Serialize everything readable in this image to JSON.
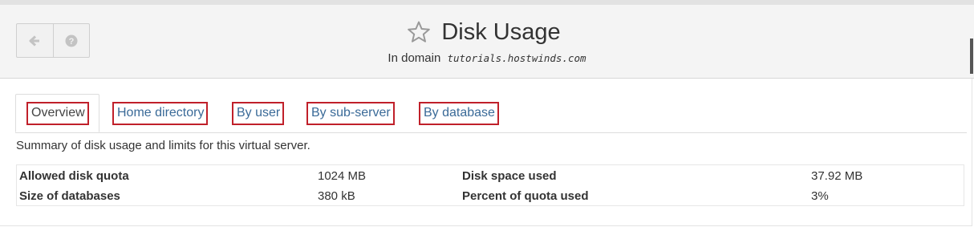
{
  "header": {
    "title": "Disk Usage",
    "subtitle_prefix": "In domain",
    "domain": "tutorials.hostwinds.com"
  },
  "toolbar": {
    "back_icon": "arrow-left-icon",
    "help_icon": "question-circle-icon"
  },
  "tabs": [
    {
      "label": "Overview",
      "active": true
    },
    {
      "label": "Home directory",
      "active": false
    },
    {
      "label": "By user",
      "active": false
    },
    {
      "label": "By sub-server",
      "active": false
    },
    {
      "label": "By database",
      "active": false
    }
  ],
  "summary": "Summary of disk usage and limits for this virtual server.",
  "stats": {
    "allowed_label": "Allowed disk quota",
    "allowed_value": "1024 MB",
    "used_label": "Disk space used",
    "used_value": "37.92 MB",
    "db_label": "Size of databases",
    "db_value": "380 kB",
    "percent_label": "Percent of quota used",
    "percent_value": "3%"
  },
  "colors": {
    "link": "#3a6a98",
    "highlight_border": "#c0202a",
    "header_bg": "#f4f4f4"
  }
}
